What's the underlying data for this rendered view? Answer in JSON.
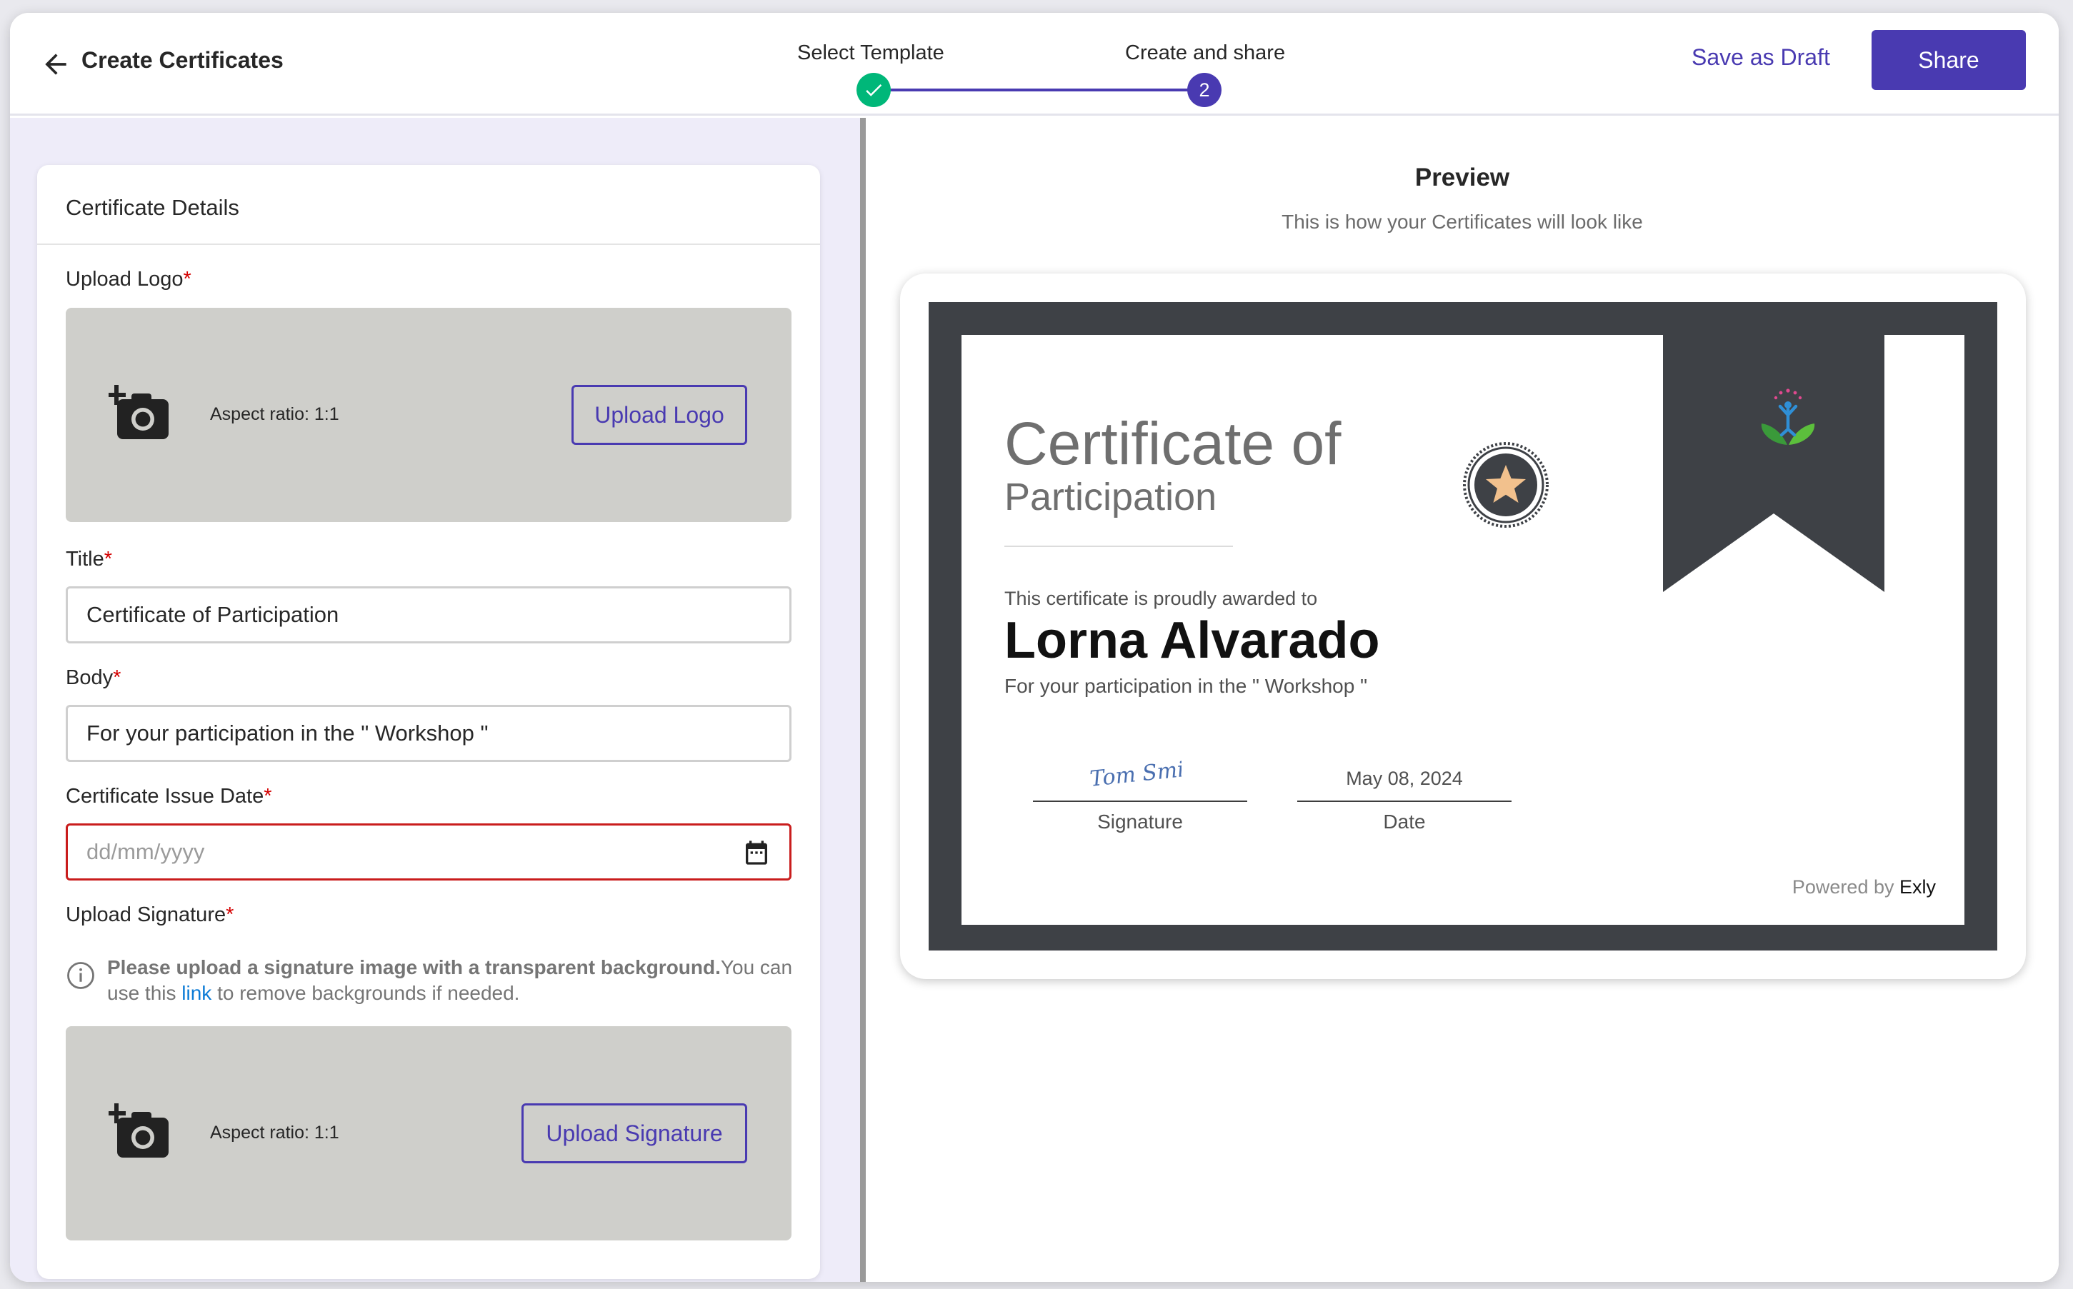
{
  "header": {
    "title": "Create Certificates",
    "save_draft_label": "Save as Draft",
    "share_label": "Share"
  },
  "stepper": {
    "steps": [
      {
        "label": "Select Template",
        "state": "completed"
      },
      {
        "label": "Create and share",
        "state": "active",
        "number": "2"
      }
    ]
  },
  "form": {
    "card_title": "Certificate Details",
    "required_mark": "*",
    "logo": {
      "label": "Upload Logo",
      "aspect": "Aspect ratio: 1:1",
      "button_label": "Upload Logo"
    },
    "title_field": {
      "label": "Title",
      "value": "Certificate of Participation"
    },
    "body_field": {
      "label": "Body",
      "value": "For your participation in the \" Workshop \""
    },
    "issue_date": {
      "label": "Certificate Issue Date",
      "placeholder": "dd/mm/yyyy"
    },
    "signature": {
      "label": "Upload Signature",
      "info_bold": "Please upload a signature image with a transparent background.",
      "info_pre": "You can use this ",
      "info_link": "link",
      "info_post": " to remove backgrounds if needed.",
      "aspect": "Aspect ratio: 1:1",
      "button_label": "Upload Signature"
    }
  },
  "preview": {
    "title": "Preview",
    "subtitle": "This is how your Certificates will look like",
    "certificate": {
      "title_line1": "Certificate of",
      "title_line2": "Participation",
      "awarded_text": "This certificate is proudly awarded to",
      "recipient": "Lorna Alvarado",
      "body": "For your participation in the \" Workshop \"",
      "signature_text": "Tom Smith",
      "signature_caption": "Signature",
      "date_value": "May 08, 2024",
      "date_caption": "Date",
      "powered_by": "Powered by ",
      "brand": "Exly"
    }
  },
  "colors": {
    "accent": "#493ab1",
    "success": "#00b779",
    "error": "#c91d1d",
    "left_panel_bg": "#eeecf9",
    "upload_box_bg": "#cfcfcb",
    "certificate_frame": "#3e4146"
  },
  "icons": [
    "back-arrow-icon",
    "check-icon",
    "camera-add-icon",
    "calendar-icon",
    "info-icon",
    "star-badge-icon",
    "yoga-logo-icon"
  ]
}
